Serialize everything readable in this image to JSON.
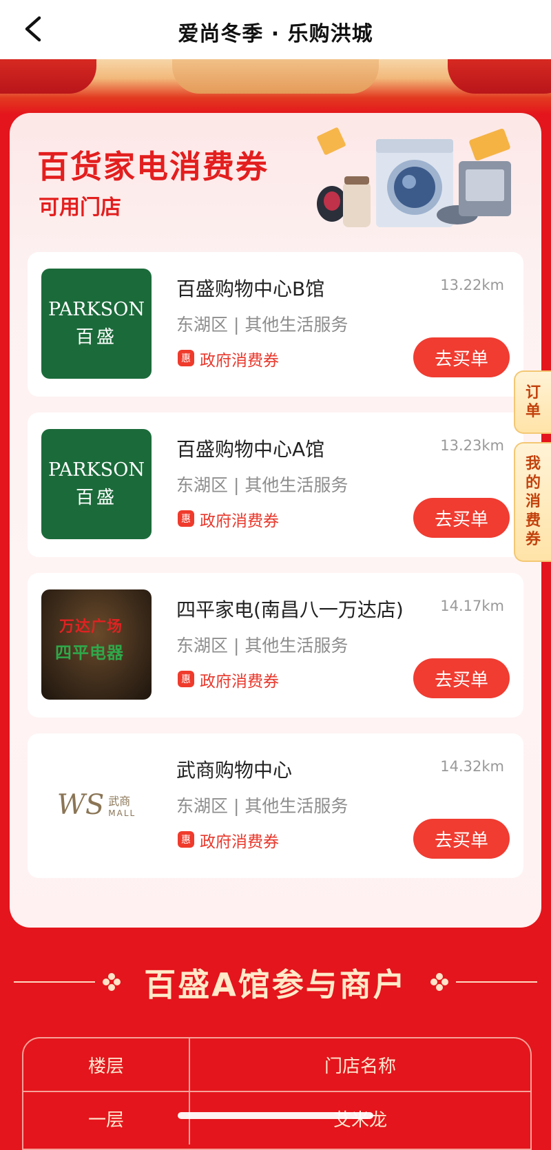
{
  "nav": {
    "title": "爱尚冬季 · 乐购洪城"
  },
  "card": {
    "heading": "百货家电消费券",
    "subheading": "可用门店"
  },
  "stores": [
    {
      "name": "百盛购物中心B馆",
      "distance": "13.22km",
      "category": "东湖区 | 其他生活服务",
      "badge": "惠",
      "coupon": "政府消费券",
      "button": "去买单",
      "logo_line1": "PARKSON",
      "logo_line2": "百盛"
    },
    {
      "name": "百盛购物中心A馆",
      "distance": "13.23km",
      "category": "东湖区 | 其他生活服务",
      "badge": "惠",
      "coupon": "政府消费券",
      "button": "去买单",
      "logo_line1": "PARKSON",
      "logo_line2": "百盛"
    },
    {
      "name": "四平家电(南昌八一万达店)",
      "distance": "14.17km",
      "category": "东湖区 | 其他生活服务",
      "badge": "惠",
      "coupon": "政府消费券",
      "button": "去买单",
      "logo_line1": "万达广场",
      "logo_line2": "四平电器"
    },
    {
      "name": "武商购物中心",
      "distance": "14.32km",
      "category": "东湖区 | 其他生活服务",
      "badge": "惠",
      "coupon": "政府消费券",
      "button": "去买单",
      "logo_line1": "WS",
      "logo_line2": "武商",
      "logo_line3": "MALL"
    }
  ],
  "side_tabs": {
    "orders": "订单",
    "my_coupons": "我的消费券"
  },
  "section": {
    "title": "百盛A馆参与商户"
  },
  "table": {
    "headers": [
      "楼层",
      "门店名称"
    ],
    "rows": [
      [
        "一层",
        "艾米龙"
      ]
    ]
  },
  "colors": {
    "brand_red": "#e4151c",
    "button_red": "#f03c31",
    "parkson_green": "#1b6b3a"
  }
}
